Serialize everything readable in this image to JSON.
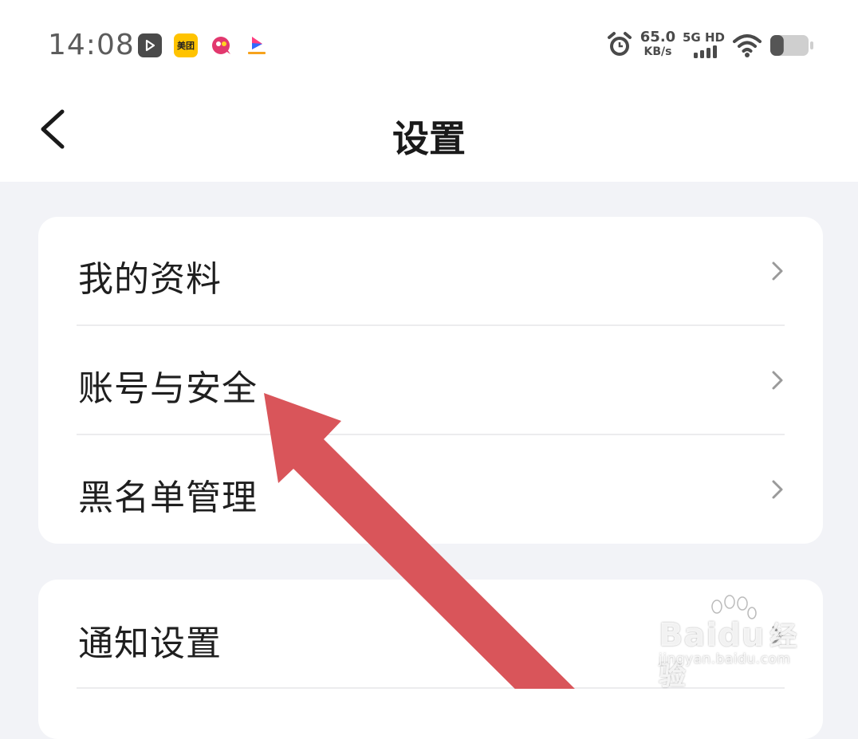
{
  "status_bar": {
    "time": "14:08",
    "apps": [
      {
        "name": "play-app-icon",
        "glyph": "▷"
      },
      {
        "name": "meituan-app-icon",
        "glyph": "美团"
      },
      {
        "name": "chat-app-icon",
        "glyph": ""
      },
      {
        "name": "video-app-icon",
        "glyph": ""
      }
    ],
    "net_speed_value": "65.0",
    "net_speed_unit": "KB/s",
    "network_type": "5G HD",
    "battery_level": 0.35
  },
  "header": {
    "title": "设置"
  },
  "settings_group_1": {
    "items": [
      {
        "label": "我的资料"
      },
      {
        "label": "账号与安全"
      },
      {
        "label": "黑名单管理"
      }
    ]
  },
  "settings_group_2": {
    "items": [
      {
        "label": "通知设置"
      }
    ]
  },
  "watermark": {
    "brand": "Baidu",
    "suffix": "经验",
    "url": "jingyan.baidu.com"
  },
  "colors": {
    "page_bg": "#f2f3f7",
    "card_bg": "#ffffff",
    "text": "#1f1f1f",
    "chevron": "#9a9a9a",
    "annotation_arrow": "#d9555a"
  }
}
